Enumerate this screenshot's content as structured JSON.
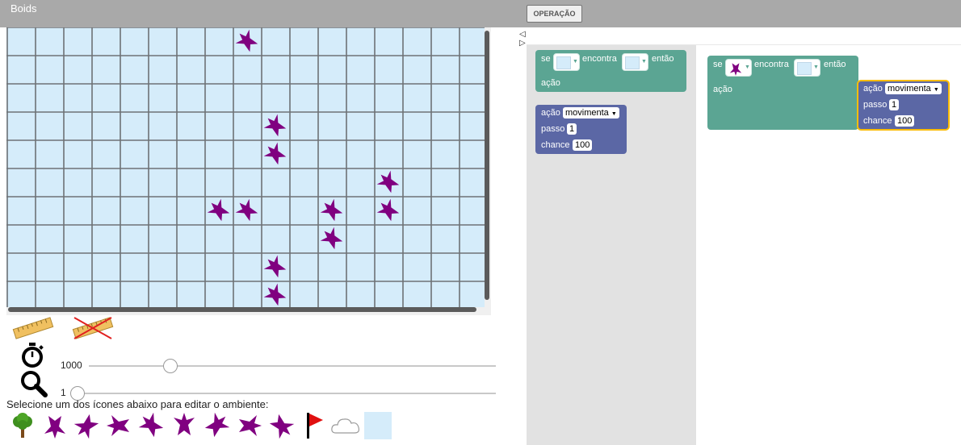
{
  "app": {
    "title": "Boids"
  },
  "toolbar": {
    "operation_label": "OPERAÇÃO"
  },
  "world": {
    "columns": 17,
    "rows": 10,
    "cell_color": "#d5ecfa",
    "line_color": "#6e7276",
    "bird_color": "#800080",
    "birds": [
      {
        "col": 8,
        "row": 0,
        "heading": "up-left"
      },
      {
        "col": 9,
        "row": 3,
        "heading": "up-left"
      },
      {
        "col": 9,
        "row": 4,
        "heading": "up-left"
      },
      {
        "col": 13,
        "row": 5,
        "heading": "up-left"
      },
      {
        "col": 7,
        "row": 6,
        "heading": "up-left"
      },
      {
        "col": 8,
        "row": 6,
        "heading": "up-left"
      },
      {
        "col": 11,
        "row": 6,
        "heading": "up-left"
      },
      {
        "col": 13,
        "row": 6,
        "heading": "up-left"
      },
      {
        "col": 11,
        "row": 7,
        "heading": "up-left"
      },
      {
        "col": 9,
        "row": 8,
        "heading": "up-left"
      },
      {
        "col": 9,
        "row": 9,
        "heading": "up-left"
      }
    ]
  },
  "controls": {
    "ruler_icon": "ruler-icon",
    "ruler_off_icon": "ruler-disabled-icon",
    "timer_icon": "stopwatch-icon",
    "zoom_icon": "magnifier-icon",
    "speed_value": "1000",
    "speed_fraction": 0.2,
    "zoom_value": "1",
    "zoom_fraction": 0.0
  },
  "palette": {
    "hint": "Selecione um dos ícones abaixo para editar o ambiente:",
    "items": [
      {
        "name": "tree-icon"
      },
      {
        "name": "bird-down-icon"
      },
      {
        "name": "bird-down-left-icon"
      },
      {
        "name": "bird-left-icon"
      },
      {
        "name": "bird-up-left-icon"
      },
      {
        "name": "bird-up-icon"
      },
      {
        "name": "bird-up-right-icon"
      },
      {
        "name": "bird-right-icon"
      },
      {
        "name": "bird-down-right-icon"
      },
      {
        "name": "flag-icon"
      },
      {
        "name": "cloud-icon"
      },
      {
        "name": "empty-cell-icon"
      }
    ]
  },
  "flyout": {
    "if_block": {
      "se": "se",
      "encontra": "encontra",
      "entao": "então",
      "acao": "ação"
    },
    "action_block": {
      "acao": "ação",
      "acao_value": "movimenta",
      "passo": "passo",
      "passo_value": "1",
      "chance": "chance",
      "chance_value": "100"
    }
  },
  "workspace": {
    "if_block": {
      "se": "se",
      "encontra": "encontra",
      "entao": "então",
      "acao": "ação"
    },
    "action_block": {
      "acao": "ação",
      "acao_value": "movimenta",
      "passo": "passo",
      "passo_value": "1",
      "chance": "chance",
      "chance_value": "100"
    }
  },
  "colors": {
    "condition_block": "#5ba593",
    "action_block": "#5b67a5",
    "selection": "#fbbc05",
    "topbar": "#a9a9a9"
  }
}
